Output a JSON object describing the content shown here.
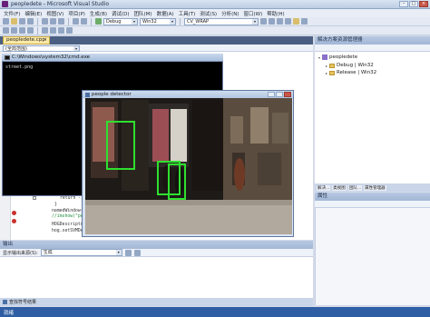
{
  "window": {
    "title": "peopledete - Microsoft Visual Studio"
  },
  "menu": [
    "文件(F)",
    "编辑(E)",
    "视图(V)",
    "项目(P)",
    "生成(B)",
    "调试(D)",
    "团队(M)",
    "数据(A)",
    "工具(T)",
    "测试(S)",
    "分析(N)",
    "窗口(W)",
    "帮助(H)"
  ],
  "toolbar": {
    "config_combo": "Debug",
    "platform_combo": "Win32",
    "find_combo": "CV_WRAP"
  },
  "editor": {
    "tab_label": "peopledete.cpp",
    "tab_close": "×",
    "nav_scope": "(全局范围)",
    "code_lines": [
      {
        "text": "return -1;",
        "class": "kw"
      },
      {
        "text": "}",
        "class": ""
      },
      {
        "text": "namedWindow(\"",
        "class": ""
      },
      {
        "text": "//imshow(\"peo",
        "class": "cm"
      },
      {
        "text": "",
        "class": ""
      },
      {
        "text": "HOGDescripto",
        "class": ""
      },
      {
        "text": "hog.setSVMDe",
        "class": ""
      }
    ]
  },
  "console": {
    "title": "C:\\Windows\\system32\\cmd.exe",
    "text": "street.png"
  },
  "detector": {
    "title": "people detector"
  },
  "solution_explorer": {
    "header": "解决方案资源管理器",
    "items": [
      {
        "label": "peopledete",
        "type": "project",
        "indent": 0
      },
      {
        "label": "Debug | Win32",
        "type": "folder",
        "indent": 1
      },
      {
        "label": "Release | Win32",
        "type": "folder",
        "indent": 1
      }
    ],
    "tabs": [
      "解决...",
      "类视图",
      "团队...",
      "属性管理器"
    ]
  },
  "properties": {
    "header": "属性"
  },
  "output": {
    "header": "输出",
    "show_from_label": "显示输出来源(S):",
    "show_from_value": "生成"
  },
  "bottom_tabs": {
    "label": "查找符号结果"
  },
  "statusbar": {
    "text": "就绪"
  },
  "colors": {
    "accent": "#2f5ea4",
    "detection_box": "#2ee02e"
  }
}
